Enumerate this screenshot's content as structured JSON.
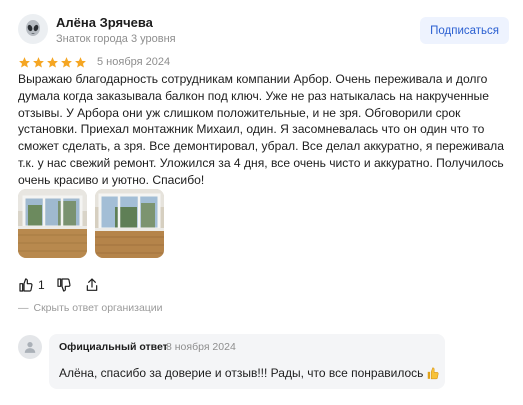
{
  "review": {
    "author_name": "Алёна Зрячева",
    "author_level": "Знаток города 3 уровня",
    "subscribe_label": "Подписаться",
    "rating": 5,
    "date": "5 ноября 2024",
    "text": "Выражаю благодарность сотрудникам компании Арбор. Очень переживала и долго думала когда заказывала балкон под ключ. Уже не раз натыкалась на накрученные отзывы. У Арбора они уж слишком положительные, и не зря. Обговорили срок установки. Приехал монтажник Михаил, один. Я засомневалась что он один что то сможет сделать, а зря. Все демонтировал, убрал. Все делал аккуратно, я переживала т.к. у нас свежий ремонт. Уложился за 4 дня, все очень чисто и аккуратно. Получилось очень красиво и уютно. Спасибо!",
    "photos": [
      {
        "alt_icon": "balcony-photo-1"
      },
      {
        "alt_icon": "balcony-photo-2"
      }
    ],
    "likes": "1",
    "hide_reply_label": "Скрыть ответ организации"
  },
  "official_reply": {
    "title": "Официальный ответ",
    "date": "8 ноября 2024",
    "text": "Алёна, спасибо за доверие и отзыв!!! Рады, что все понравилось"
  },
  "colors": {
    "star": "#f5a623",
    "accent": "#2a5fd1",
    "subscribe_bg": "#eef3fe",
    "reply_bg": "#f4f5f7",
    "muted": "#8e8e8e"
  }
}
